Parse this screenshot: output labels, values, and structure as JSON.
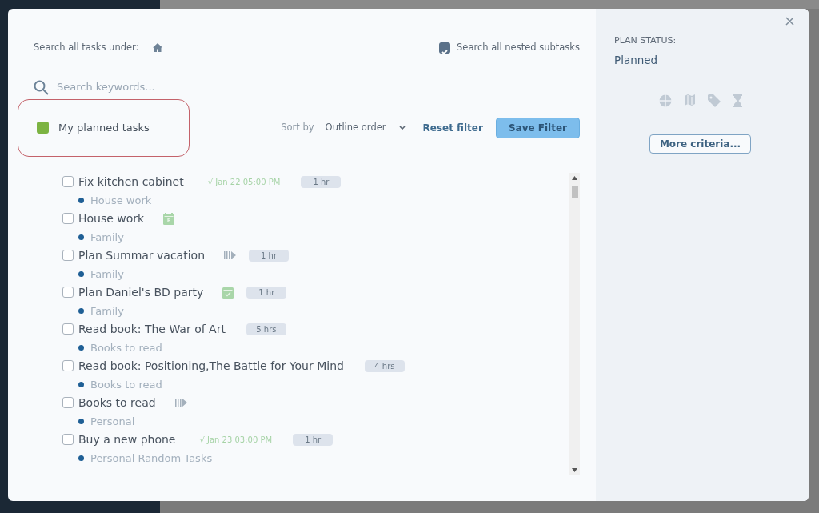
{
  "search_scope": {
    "label": "Search all tasks under:"
  },
  "nested_subtasks": {
    "label": "Search all nested subtasks",
    "checked": true
  },
  "search": {
    "placeholder": "Search keywords..."
  },
  "saved_filter": {
    "label": "My planned tasks",
    "color": "#7cb342"
  },
  "sort": {
    "label": "Sort by",
    "value": "Outline order"
  },
  "reset_filter": "Reset filter",
  "save_filter": "Save Filter",
  "tasks": [
    {
      "name": "Fix kitchen cabinet",
      "checked": false,
      "date": "√ Jan 22 05:00 PM",
      "duration": "1 hr",
      "project": "House work"
    },
    {
      "name": "House work",
      "checked": false,
      "kind": "calendar",
      "project": "Family"
    },
    {
      "name": "Plan Summar vacation",
      "checked": false,
      "kind": "progress",
      "duration": "1 hr",
      "project": "Family"
    },
    {
      "name": "Plan Daniel's BD party",
      "checked": false,
      "kind": "done",
      "duration": "1 hr",
      "project": "Family"
    },
    {
      "name": "Read book: The War of Art",
      "checked": false,
      "duration": "5 hrs",
      "project": "Books to read"
    },
    {
      "name": "Read book: Positioning,The Battle for Your Mind",
      "checked": false,
      "duration": "4 hrs",
      "project": "Books to read"
    },
    {
      "name": "Books to read",
      "checked": false,
      "kind": "progress",
      "project": "Personal"
    },
    {
      "name": "Buy a new phone",
      "checked": false,
      "date": "√ Jan 23 03:00 PM",
      "duration": "1 hr",
      "project": "Personal Random Tasks"
    }
  ],
  "plan_status": {
    "label": "PLAN STATUS:",
    "value": "Planned"
  },
  "more_criteria": "More criteria..."
}
